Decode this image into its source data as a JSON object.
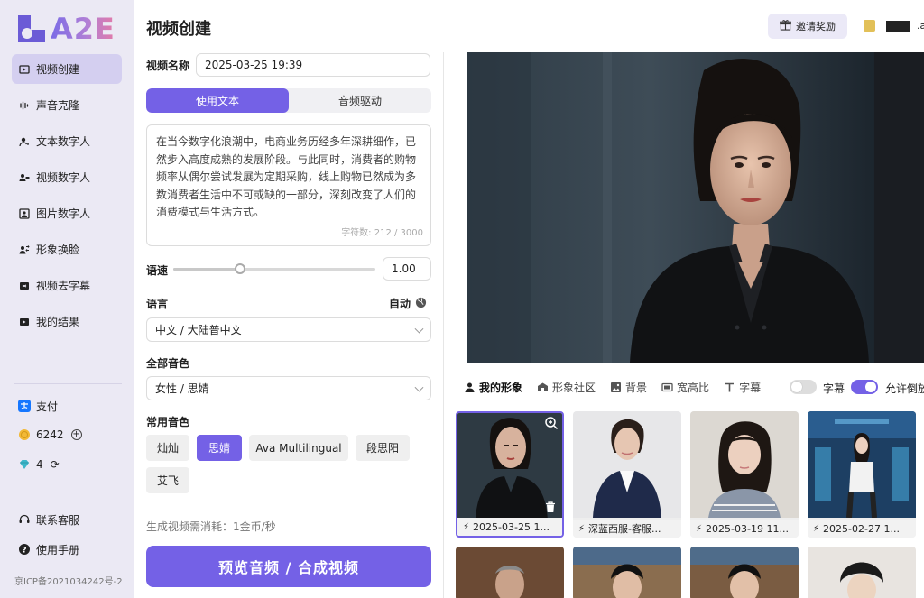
{
  "brand": {
    "logo_text": "A2E"
  },
  "sidebar": {
    "items": [
      {
        "label": "视频创建",
        "icon": "video-create-icon",
        "active": true
      },
      {
        "label": "声音克隆",
        "icon": "voice-clone-icon"
      },
      {
        "label": "文本数字人",
        "icon": "text-avatar-icon"
      },
      {
        "label": "视频数字人",
        "icon": "video-avatar-icon"
      },
      {
        "label": "图片数字人",
        "icon": "image-avatar-icon"
      },
      {
        "label": "形象换脸",
        "icon": "face-swap-icon"
      },
      {
        "label": "视频去字幕",
        "icon": "remove-subtitle-icon"
      },
      {
        "label": "我的结果",
        "icon": "results-icon"
      }
    ],
    "pay_label": "支付",
    "coins": "6242",
    "diamonds": "4",
    "support_label": "联系客服",
    "manual_label": "使用手册",
    "icp": "京ICP备2021034242号-2"
  },
  "header": {
    "title": "视频创建",
    "invite_label": "邀请奖励",
    "user_tail": ".a"
  },
  "form": {
    "name_label": "视频名称",
    "name_value": "2025-03-25 19:39",
    "mode_tabs": [
      "使用文本",
      "音频驱动"
    ],
    "text_value": "在当今数字化浪潮中，电商业务历经多年深耕细作，已然步入高度成熟的发展阶段。与此同时，消费者的购物频率从偶尔尝试发展为定期采购，线上购物已然成为多数消费者生活中不可或缺的一部分，深刻改变了人们的消费模式与生活方式。",
    "char_count": "字符数: 212 / 3000",
    "speed_label": "语速",
    "speed_value": "1.00",
    "speed_level": 0.33,
    "language_label": "语言",
    "language_auto": "自动",
    "language_value": "中文 / 大陆普中文",
    "voices_label": "全部音色",
    "voice_value": "女性 / 思婧",
    "common_voices_label": "常用音色",
    "common_voices": [
      "灿灿",
      "思婧",
      "Ava Multilingual",
      "段思阳",
      "艾飞"
    ],
    "selected_voice": "思婧",
    "cost_text": "生成视频需消耗：1金币/秒",
    "generate_label": "预览音频 / 合成视频"
  },
  "gallery": {
    "tabs": [
      "我的形象",
      "形象社区",
      "背景",
      "宽高比",
      "字幕"
    ],
    "subtitle_toggle_label": "字幕",
    "subtitle_on": false,
    "reverse_toggle_label": "允许倒放",
    "reverse_on": true,
    "cards": [
      {
        "caption": "2025-03-25 1...",
        "selected": true
      },
      {
        "caption": "深蓝西服-客服..."
      },
      {
        "caption": "2025-03-19 11..."
      },
      {
        "caption": "2025-02-27 1..."
      }
    ]
  },
  "colors": {
    "accent": "#7461e6",
    "sidebar_bg": "#ebe9f4",
    "active_nav": "#d4cff0"
  }
}
